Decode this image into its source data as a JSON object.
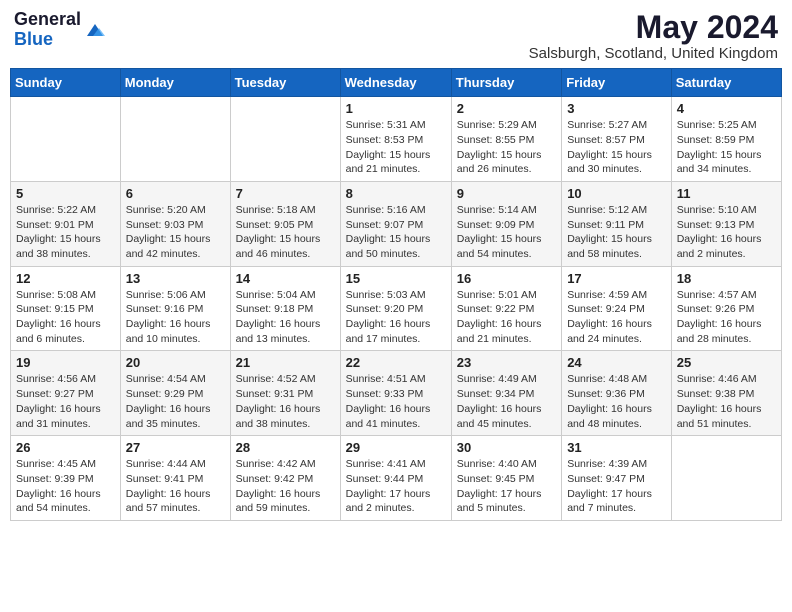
{
  "header": {
    "logo_general": "General",
    "logo_blue": "Blue",
    "month_year": "May 2024",
    "location": "Salsburgh, Scotland, United Kingdom"
  },
  "days_of_week": [
    "Sunday",
    "Monday",
    "Tuesday",
    "Wednesday",
    "Thursday",
    "Friday",
    "Saturday"
  ],
  "weeks": [
    [
      {
        "day": "",
        "info": ""
      },
      {
        "day": "",
        "info": ""
      },
      {
        "day": "",
        "info": ""
      },
      {
        "day": "1",
        "info": "Sunrise: 5:31 AM\nSunset: 8:53 PM\nDaylight: 15 hours and 21 minutes."
      },
      {
        "day": "2",
        "info": "Sunrise: 5:29 AM\nSunset: 8:55 PM\nDaylight: 15 hours and 26 minutes."
      },
      {
        "day": "3",
        "info": "Sunrise: 5:27 AM\nSunset: 8:57 PM\nDaylight: 15 hours and 30 minutes."
      },
      {
        "day": "4",
        "info": "Sunrise: 5:25 AM\nSunset: 8:59 PM\nDaylight: 15 hours and 34 minutes."
      }
    ],
    [
      {
        "day": "5",
        "info": "Sunrise: 5:22 AM\nSunset: 9:01 PM\nDaylight: 15 hours and 38 minutes."
      },
      {
        "day": "6",
        "info": "Sunrise: 5:20 AM\nSunset: 9:03 PM\nDaylight: 15 hours and 42 minutes."
      },
      {
        "day": "7",
        "info": "Sunrise: 5:18 AM\nSunset: 9:05 PM\nDaylight: 15 hours and 46 minutes."
      },
      {
        "day": "8",
        "info": "Sunrise: 5:16 AM\nSunset: 9:07 PM\nDaylight: 15 hours and 50 minutes."
      },
      {
        "day": "9",
        "info": "Sunrise: 5:14 AM\nSunset: 9:09 PM\nDaylight: 15 hours and 54 minutes."
      },
      {
        "day": "10",
        "info": "Sunrise: 5:12 AM\nSunset: 9:11 PM\nDaylight: 15 hours and 58 minutes."
      },
      {
        "day": "11",
        "info": "Sunrise: 5:10 AM\nSunset: 9:13 PM\nDaylight: 16 hours and 2 minutes."
      }
    ],
    [
      {
        "day": "12",
        "info": "Sunrise: 5:08 AM\nSunset: 9:15 PM\nDaylight: 16 hours and 6 minutes."
      },
      {
        "day": "13",
        "info": "Sunrise: 5:06 AM\nSunset: 9:16 PM\nDaylight: 16 hours and 10 minutes."
      },
      {
        "day": "14",
        "info": "Sunrise: 5:04 AM\nSunset: 9:18 PM\nDaylight: 16 hours and 13 minutes."
      },
      {
        "day": "15",
        "info": "Sunrise: 5:03 AM\nSunset: 9:20 PM\nDaylight: 16 hours and 17 minutes."
      },
      {
        "day": "16",
        "info": "Sunrise: 5:01 AM\nSunset: 9:22 PM\nDaylight: 16 hours and 21 minutes."
      },
      {
        "day": "17",
        "info": "Sunrise: 4:59 AM\nSunset: 9:24 PM\nDaylight: 16 hours and 24 minutes."
      },
      {
        "day": "18",
        "info": "Sunrise: 4:57 AM\nSunset: 9:26 PM\nDaylight: 16 hours and 28 minutes."
      }
    ],
    [
      {
        "day": "19",
        "info": "Sunrise: 4:56 AM\nSunset: 9:27 PM\nDaylight: 16 hours and 31 minutes."
      },
      {
        "day": "20",
        "info": "Sunrise: 4:54 AM\nSunset: 9:29 PM\nDaylight: 16 hours and 35 minutes."
      },
      {
        "day": "21",
        "info": "Sunrise: 4:52 AM\nSunset: 9:31 PM\nDaylight: 16 hours and 38 minutes."
      },
      {
        "day": "22",
        "info": "Sunrise: 4:51 AM\nSunset: 9:33 PM\nDaylight: 16 hours and 41 minutes."
      },
      {
        "day": "23",
        "info": "Sunrise: 4:49 AM\nSunset: 9:34 PM\nDaylight: 16 hours and 45 minutes."
      },
      {
        "day": "24",
        "info": "Sunrise: 4:48 AM\nSunset: 9:36 PM\nDaylight: 16 hours and 48 minutes."
      },
      {
        "day": "25",
        "info": "Sunrise: 4:46 AM\nSunset: 9:38 PM\nDaylight: 16 hours and 51 minutes."
      }
    ],
    [
      {
        "day": "26",
        "info": "Sunrise: 4:45 AM\nSunset: 9:39 PM\nDaylight: 16 hours and 54 minutes."
      },
      {
        "day": "27",
        "info": "Sunrise: 4:44 AM\nSunset: 9:41 PM\nDaylight: 16 hours and 57 minutes."
      },
      {
        "day": "28",
        "info": "Sunrise: 4:42 AM\nSunset: 9:42 PM\nDaylight: 16 hours and 59 minutes."
      },
      {
        "day": "29",
        "info": "Sunrise: 4:41 AM\nSunset: 9:44 PM\nDaylight: 17 hours and 2 minutes."
      },
      {
        "day": "30",
        "info": "Sunrise: 4:40 AM\nSunset: 9:45 PM\nDaylight: 17 hours and 5 minutes."
      },
      {
        "day": "31",
        "info": "Sunrise: 4:39 AM\nSunset: 9:47 PM\nDaylight: 17 hours and 7 minutes."
      },
      {
        "day": "",
        "info": ""
      }
    ]
  ]
}
